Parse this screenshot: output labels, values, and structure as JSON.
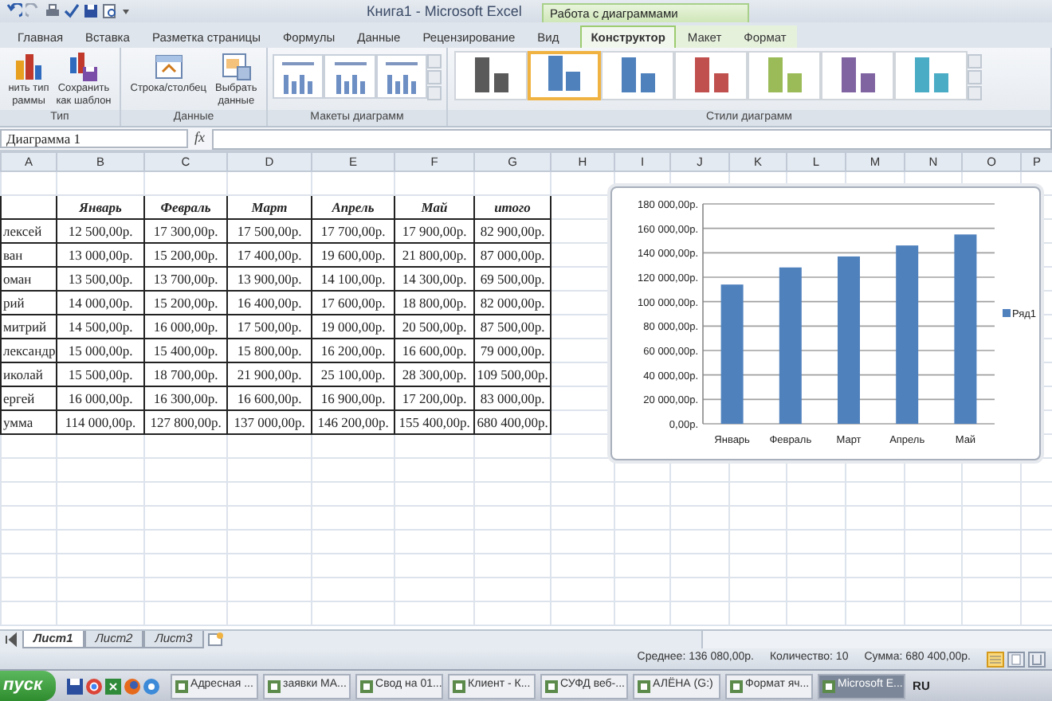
{
  "window": {
    "title": "Книга1 - Microsoft Excel",
    "context_header": "Работа с диаграммами"
  },
  "ribbon": {
    "tabs": [
      {
        "label": "Главная",
        "selected": false,
        "contextual": false
      },
      {
        "label": "Вставка",
        "selected": false,
        "contextual": false
      },
      {
        "label": "Разметка страницы",
        "selected": false,
        "contextual": false
      },
      {
        "label": "Формулы",
        "selected": false,
        "contextual": false
      },
      {
        "label": "Данные",
        "selected": false,
        "contextual": false
      },
      {
        "label": "Рецензирование",
        "selected": false,
        "contextual": false
      },
      {
        "label": "Вид",
        "selected": false,
        "contextual": false
      },
      {
        "label": "Конструктор",
        "selected": true,
        "contextual": true
      },
      {
        "label": "Макет",
        "selected": false,
        "contextual": true
      },
      {
        "label": "Формат",
        "selected": false,
        "contextual": true
      }
    ],
    "groups": [
      {
        "label": "Тип",
        "kind": "buttons",
        "buttons": [
          {
            "label": "нить тип\nраммы"
          },
          {
            "label": "Сохранить\nкак шаблон"
          }
        ]
      },
      {
        "label": "Данные",
        "kind": "buttons",
        "buttons": [
          {
            "label": "Строка/столбец"
          },
          {
            "label": "Выбрать\nданные"
          }
        ]
      },
      {
        "label": "Макеты диаграмм",
        "kind": "layouts"
      },
      {
        "label": "Стили диаграмм",
        "kind": "styles",
        "styles": [
          {
            "color": "#5a5a5a",
            "selected": false
          },
          {
            "color": "#4f81bd",
            "selected": true
          },
          {
            "color": "#4f81bd",
            "selected": false
          },
          {
            "color": "#c0504d",
            "selected": false
          },
          {
            "color": "#9bbb59",
            "selected": false
          },
          {
            "color": "#8064a2",
            "selected": false
          },
          {
            "color": "#4bacc6",
            "selected": false
          }
        ]
      }
    ]
  },
  "formula_bar": {
    "name_box": "Диаграмма 1",
    "fx": "fx"
  },
  "sheet": {
    "columns": [
      "A",
      "B",
      "C",
      "D",
      "E",
      "F",
      "G",
      "H",
      "I",
      "J",
      "K",
      "L",
      "M",
      "N",
      "O",
      "P"
    ],
    "rows": [
      {
        "kind": "header",
        "cells": [
          "",
          "Январь",
          "Февраль",
          "Март",
          "Апрель",
          "Май",
          "итого"
        ]
      },
      {
        "kind": "data",
        "cells": [
          "лексей",
          "12 500,00р.",
          "17 300,00р.",
          "17 500,00р.",
          "17 700,00р.",
          "17 900,00р.",
          "82 900,00р."
        ]
      },
      {
        "kind": "data",
        "cells": [
          "ван",
          "13 000,00р.",
          "15 200,00р.",
          "17 400,00р.",
          "19 600,00р.",
          "21 800,00р.",
          "87 000,00р."
        ]
      },
      {
        "kind": "data",
        "cells": [
          "оман",
          "13 500,00р.",
          "13 700,00р.",
          "13 900,00р.",
          "14 100,00р.",
          "14 300,00р.",
          "69 500,00р."
        ]
      },
      {
        "kind": "data",
        "cells": [
          "рий",
          "14 000,00р.",
          "15 200,00р.",
          "16 400,00р.",
          "17 600,00р.",
          "18 800,00р.",
          "82 000,00р."
        ]
      },
      {
        "kind": "data",
        "cells": [
          "митрий",
          "14 500,00р.",
          "16 000,00р.",
          "17 500,00р.",
          "19 000,00р.",
          "20 500,00р.",
          "87 500,00р."
        ]
      },
      {
        "kind": "data",
        "cells": [
          "лександр",
          "15 000,00р.",
          "15 400,00р.",
          "15 800,00р.",
          "16 200,00р.",
          "16 600,00р.",
          "79 000,00р."
        ]
      },
      {
        "kind": "data",
        "cells": [
          "иколай",
          "15 500,00р.",
          "18 700,00р.",
          "21 900,00р.",
          "25 100,00р.",
          "28 300,00р.",
          "109 500,00р."
        ]
      },
      {
        "kind": "data",
        "cells": [
          "ергей",
          "16 000,00р.",
          "16 300,00р.",
          "16 600,00р.",
          "16 900,00р.",
          "17 200,00р.",
          "83 000,00р."
        ]
      },
      {
        "kind": "total",
        "cells": [
          "умма",
          "114 000,00р.",
          "127 800,00р.",
          "137 000,00р.",
          "146 200,00р.",
          "155 400,00р.",
          "680 400,00р."
        ]
      }
    ]
  },
  "chart": {
    "chart_data": {
      "type": "bar",
      "categories": [
        "Январь",
        "Февраль",
        "Март",
        "Апрель",
        "Май"
      ],
      "series": [
        {
          "name": "Ряд1",
          "color": "#4f81bd",
          "values": [
            114000,
            128000,
            137000,
            146000,
            155000
          ]
        }
      ],
      "grid": true,
      "ylim": [
        0,
        180000
      ],
      "yticks": [
        {
          "value": 0,
          "label": "0,00р."
        },
        {
          "value": 20000,
          "label": "20 000,00р."
        },
        {
          "value": 40000,
          "label": "40 000,00р."
        },
        {
          "value": 60000,
          "label": "60 000,00р."
        },
        {
          "value": 80000,
          "label": "80 000,00р."
        },
        {
          "value": 100000,
          "label": "100 000,00р."
        },
        {
          "value": 120000,
          "label": "120 000,00р."
        },
        {
          "value": 140000,
          "label": "140 000,00р."
        },
        {
          "value": 160000,
          "label": "160 000,00р."
        },
        {
          "value": 180000,
          "label": "180 000,00р."
        }
      ]
    }
  },
  "sheet_tabs": [
    {
      "label": "Лист1",
      "selected": true
    },
    {
      "label": "Лист2",
      "selected": false
    },
    {
      "label": "Лист3",
      "selected": false
    }
  ],
  "status_bar": [
    "Среднее: 136 080,00р.",
    "Количество: 10",
    "Сумма: 680 400,00р."
  ],
  "taskbar": {
    "start": "пуск",
    "items": [
      {
        "label": "Адресная ...",
        "selected": false
      },
      {
        "label": "заявки МА...",
        "selected": false
      },
      {
        "label": "Свод на 01...",
        "selected": false
      },
      {
        "label": "Клиент - К...",
        "selected": false
      },
      {
        "label": "СУФД веб-...",
        "selected": false
      },
      {
        "label": "АЛЁНА (G:)",
        "selected": false
      },
      {
        "label": "Формат яч...",
        "selected": false
      },
      {
        "label": "Microsoft E...",
        "selected": true
      }
    ],
    "language": "RU"
  }
}
